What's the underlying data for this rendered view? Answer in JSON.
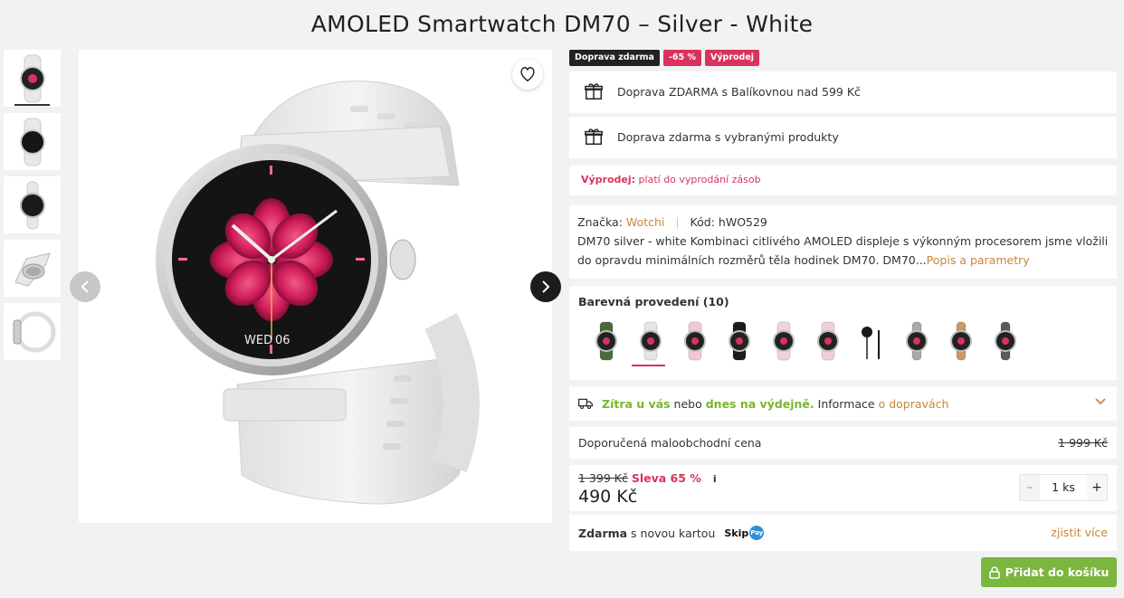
{
  "product": {
    "title": "AMOLED Smartwatch DM70 – Silver - White"
  },
  "gallery": {
    "thumbnails": [
      "front-dark-face",
      "black-screen",
      "side-profile",
      "angled-side",
      "flat-side"
    ],
    "active_thumbnail": 0,
    "wishlist_icon": "heart-icon",
    "prev_icon": "chevron-left-icon",
    "next_icon": "chevron-right-icon",
    "watch_date": "WED",
    "watch_day": "06"
  },
  "badges": [
    {
      "label": "Doprava zdarma",
      "color": "#222222"
    },
    {
      "label": "-65 %",
      "color": "#d9335b"
    },
    {
      "label": "Výprodej",
      "color": "#d9335b"
    }
  ],
  "shipping": [
    {
      "icon": "gift-icon",
      "text": "Doprava ZDARMA s Balíkovnou nad 599 Kč"
    },
    {
      "icon": "gift-icon",
      "text": "Doprava zdarma s vybranými produkty"
    }
  ],
  "sale": {
    "label": "Výprodej:",
    "text": " platí do vyprodání zásob"
  },
  "info": {
    "brand_label": "Značka:",
    "brand": "Wotchi",
    "code_label": "Kód:",
    "code": "hWO529",
    "description": "DM70 silver - white Kombinaci citlivého AMOLED displeje s výkonným procesorem jsme vložili do opravdu minimálních rozměrů těla hodinek DM70. DM70...",
    "more_link": "Popis a parametry"
  },
  "colors": {
    "title": "Barevná provedení (10)",
    "variants": [
      {
        "strap": "#4a6a3c",
        "face": "#222",
        "kind": "round"
      },
      {
        "strap": "#e6e6e6",
        "face": "#222",
        "kind": "round"
      },
      {
        "strap": "#f2c9d2",
        "face": "#222",
        "kind": "round"
      },
      {
        "strap": "#1c1c1c",
        "face": "#222",
        "kind": "round"
      },
      {
        "strap": "#f0d3da",
        "face": "#222",
        "kind": "round"
      },
      {
        "strap": "#f0cfd7",
        "face": "#222",
        "kind": "round"
      },
      {
        "strap": "#1a1a1a",
        "face": "#1a1a1a",
        "kind": "charger"
      },
      {
        "strap": "#a9a9a9",
        "face": "#222",
        "kind": "mesh"
      },
      {
        "strap": "#c79a66",
        "face": "#222",
        "kind": "mesh"
      },
      {
        "strap": "#5a5a5a",
        "face": "#222",
        "kind": "mesh"
      }
    ],
    "active_index": 1,
    "accent": "#d9335b"
  },
  "delivery": {
    "icon": "truck-icon",
    "part1": "Zítra u vás",
    "part2": " nebo ",
    "part3": "dnes na výdejně.",
    "part4": " Informace ",
    "link": "o dopravách",
    "chevron": "chevron-down-icon"
  },
  "rrp": {
    "label": "Doporučená maloobchodní cena",
    "value": "1 999 Kč"
  },
  "price": {
    "old": "1 399 Kč",
    "discount": "Sleva 65 %",
    "info_icon": "i",
    "current": "490 Kč",
    "qty_minus": "–",
    "qty_value": "1 ks",
    "qty_plus": "+"
  },
  "skip": {
    "bold": "Zdarma",
    "text": " s novou kartou",
    "logo_text": "Skip",
    "logo_badge": "Pay",
    "link": "zjistit více"
  },
  "cart": {
    "label": "Přidat do košíku",
    "icon": "lock-icon",
    "color": "#7bb63f"
  }
}
